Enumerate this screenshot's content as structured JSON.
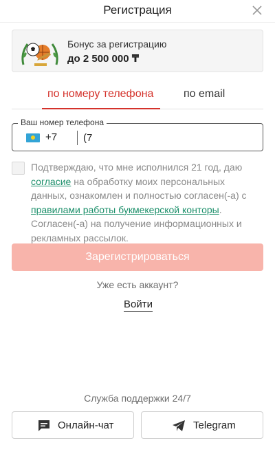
{
  "header": {
    "title": "Регистрация",
    "close_icon": "close-icon"
  },
  "bonus": {
    "title": "Бонус за регистрацию",
    "amount": "до 2 500 000 ₸",
    "icon": "trophy-icon"
  },
  "tabs": [
    {
      "label": "по номеру телефона",
      "active": true
    },
    {
      "label": "по email",
      "active": false
    }
  ],
  "phone": {
    "label": "Ваш номер телефона",
    "country_code": "+7",
    "value": "(7",
    "flag_icon": "kazakhstan-flag-icon"
  },
  "agreement": {
    "text_1": "Подтверждаю, что мне исполнился 21 год, даю ",
    "link_1": "согласие",
    "text_2": " на обработку моих персональных данных, ознакомлен и полностью согласен(-а) с ",
    "link_2": "правилами работы букмекерской конторы",
    "text_3": ". Согласен(-а) на получение информационных и рекламных рассылок.",
    "checked": false
  },
  "register_button": "Зарегистрироваться",
  "have_account": "Уже есть аккаунт?",
  "login_link": "Войти",
  "support": {
    "title": "Служба поддержки 24/7",
    "chat_label": "Онлайн-чат",
    "telegram_label": "Telegram",
    "chat_icon": "chat-icon",
    "telegram_icon": "telegram-icon"
  },
  "colors": {
    "accent": "#d4322b",
    "register_disabled": "#f8b4ab",
    "link": "#1b8f6a"
  }
}
